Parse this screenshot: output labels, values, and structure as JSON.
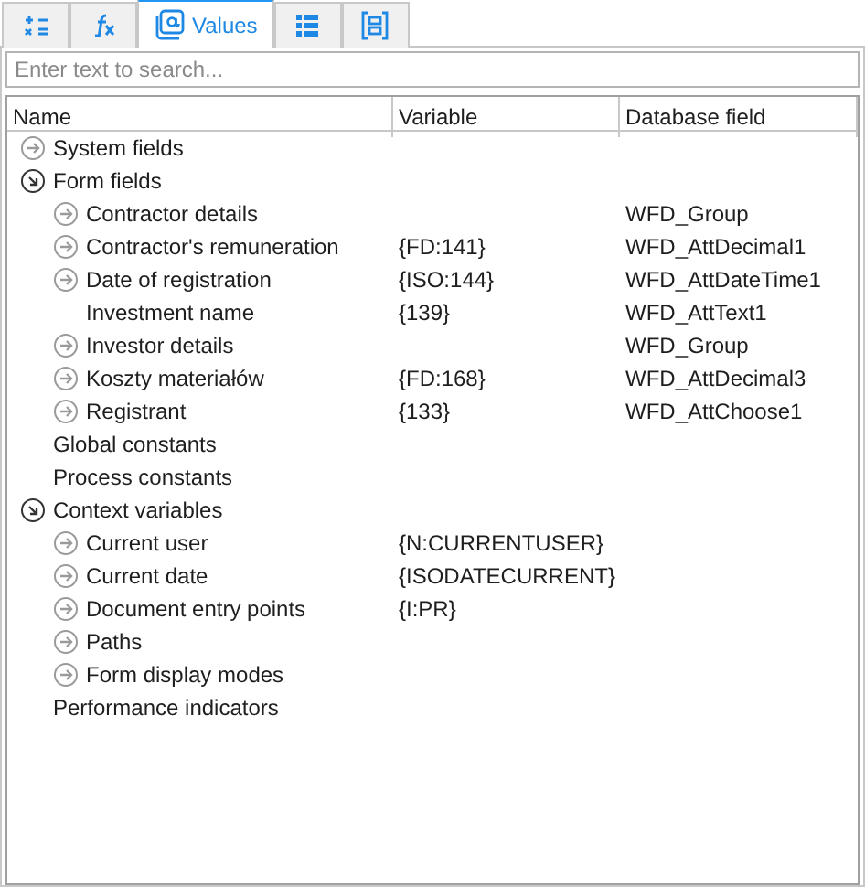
{
  "tabs": [
    {
      "selected": false
    },
    {
      "selected": false
    },
    {
      "label": "Values",
      "selected": true
    },
    {
      "selected": false
    },
    {
      "selected": false
    }
  ],
  "search": {
    "placeholder": "Enter text to search..."
  },
  "table": {
    "columns": [
      "Name",
      "Variable",
      "Database field"
    ],
    "rows": [
      {
        "name": "System fields",
        "kind": "node",
        "expanded": false
      },
      {
        "name": "Form fields",
        "kind": "node",
        "expanded": true,
        "children": [
          {
            "name": "Contractor details",
            "kind": "node",
            "expanded": false,
            "field": "WFD_Group"
          },
          {
            "name": "Contractor's remuneration",
            "kind": "node",
            "expanded": false,
            "variable": "{FD:141}",
            "field": "WFD_AttDecimal1"
          },
          {
            "name": "Date of registration",
            "kind": "node",
            "expanded": false,
            "variable": "{ISO:144}",
            "field": "WFD_AttDateTime1"
          },
          {
            "name": "Investment name",
            "kind": "leaf",
            "variable": "{139}",
            "field": "WFD_AttText1"
          },
          {
            "name": "Investor details",
            "kind": "node",
            "expanded": false,
            "field": "WFD_Group"
          },
          {
            "name": "Koszty materiałów",
            "kind": "node",
            "expanded": false,
            "variable": "{FD:168}",
            "field": "WFD_AttDecimal3"
          },
          {
            "name": "Registrant",
            "kind": "node",
            "expanded": false,
            "variable": "{133}",
            "field": "WFD_AttChoose1"
          }
        ]
      },
      {
        "name": "Global constants",
        "kind": "leaf"
      },
      {
        "name": "Process constants",
        "kind": "leaf"
      },
      {
        "name": "Context variables",
        "kind": "node",
        "expanded": true,
        "children": [
          {
            "name": "Current user",
            "kind": "node",
            "expanded": false,
            "variable": "{N:CURRENTUSER}"
          },
          {
            "name": "Current date",
            "kind": "node",
            "expanded": false,
            "variable": "{ISODATECURRENT}"
          },
          {
            "name": "Document entry points",
            "kind": "node",
            "expanded": false,
            "variable": "{I:PR}"
          },
          {
            "name": "Paths",
            "kind": "node",
            "expanded": false
          },
          {
            "name": "Form display modes",
            "kind": "node",
            "expanded": false
          }
        ]
      },
      {
        "name": "Performance indicators",
        "kind": "leaf"
      }
    ]
  }
}
